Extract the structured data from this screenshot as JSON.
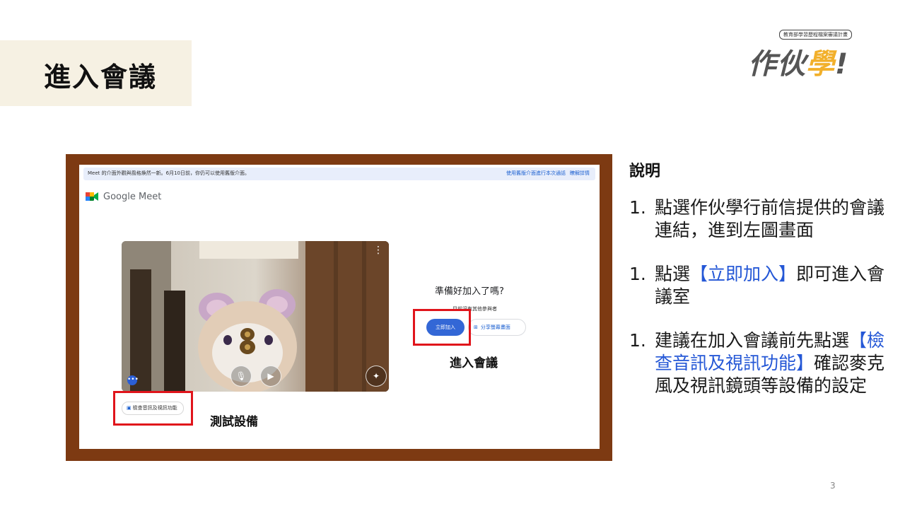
{
  "slide": {
    "title": "進入會議",
    "page_number": "3"
  },
  "logo": {
    "tagline": "教育部學習歷程檔案審議計畫",
    "name_part1": "作伙",
    "name_part2": "學",
    "name_part3": "!"
  },
  "screenshot": {
    "banner": {
      "message": "Meet 的介面外觀與風格煥然一新。6月10日前，你仍可以使用舊版介面。",
      "link_old_ui": "使用舊版介面進行本次通話",
      "link_learn_more": "瞭解詳情"
    },
    "app_name": "Google Meet",
    "check_button_label": "檢查音訊及視訊功能",
    "ready_text": "準備好加入了嗎?",
    "no_participants_text": "目前沒有其他參與者",
    "join_button_label": "立即加入",
    "share_button_label": "分享螢幕畫面"
  },
  "captions": {
    "join": "進入會議",
    "test": "測試設備"
  },
  "sidebar": {
    "heading": "說明",
    "items": [
      {
        "num": "1.",
        "text": "點選作伙學行前信提供的會議連結，進到左圖畫面"
      },
      {
        "num": "1.",
        "pre": "點選",
        "hl": "【立即加入】",
        "post": "即可進入會議室"
      },
      {
        "num": "1.",
        "pre": "建議在加入會議前先點選",
        "hl": "【檢查音訊及視訊功能】",
        "post": "確認麥克風及視訊鏡頭等設備的設定"
      }
    ]
  },
  "colors": {
    "frame": "#7d3a12",
    "title_bg": "#f6f1e3",
    "highlight_red": "#e0141b",
    "link_blue": "#2457d6",
    "meet_blue": "#3367d6",
    "logo_yellow": "#f2b02b"
  }
}
